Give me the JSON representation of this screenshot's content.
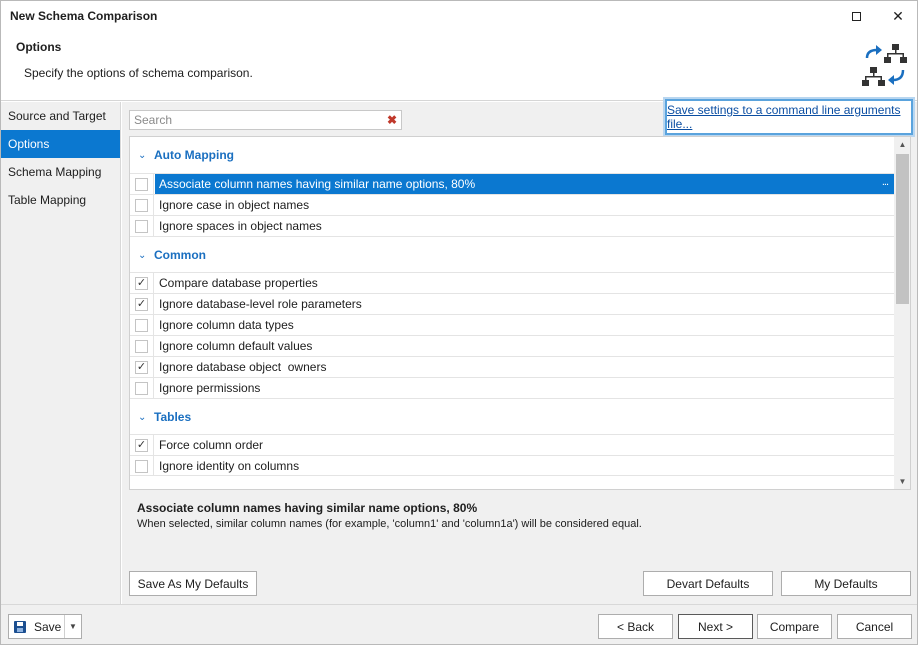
{
  "window": {
    "title": "New Schema Comparison",
    "maximize_icon": "maximize-icon",
    "close_glyph": "✕"
  },
  "header": {
    "title": "Options",
    "subtitle": "Specify the options of schema comparison.",
    "icon": "schema-compare-icon"
  },
  "sidebar": {
    "items": [
      {
        "label": "Source and Target",
        "active": false
      },
      {
        "label": "Options",
        "active": true
      },
      {
        "label": "Schema Mapping",
        "active": false
      },
      {
        "label": "Table Mapping",
        "active": false
      }
    ]
  },
  "search": {
    "placeholder": "Search",
    "value": "",
    "clear_glyph": "✖"
  },
  "save_settings_link": "Save settings to a command line arguments file...",
  "options": {
    "groups": [
      {
        "title": "Auto Mapping",
        "items": [
          {
            "label": "Associate column names having similar name options, 80%",
            "checked": false,
            "selected": true
          },
          {
            "label": "Ignore case in object names",
            "checked": false,
            "selected": false
          },
          {
            "label": "Ignore spaces in object names",
            "checked": false,
            "selected": false
          }
        ]
      },
      {
        "title": "Common",
        "items": [
          {
            "label": "Compare database properties",
            "checked": true,
            "selected": false
          },
          {
            "label": "Ignore database-level role parameters",
            "checked": true,
            "selected": false
          },
          {
            "label": "Ignore column data types",
            "checked": false,
            "selected": false
          },
          {
            "label": "Ignore column default values",
            "checked": false,
            "selected": false
          },
          {
            "label": "Ignore database object  owners",
            "checked": true,
            "selected": false
          },
          {
            "label": "Ignore permissions",
            "checked": false,
            "selected": false
          }
        ]
      },
      {
        "title": "Tables",
        "items": [
          {
            "label": "Force column order",
            "checked": true,
            "selected": false
          },
          {
            "label": "Ignore identity on columns",
            "checked": false,
            "selected": false
          }
        ]
      }
    ],
    "selected_ellipsis": "...",
    "check_glyph": "✓",
    "chevron_glyph": "⌄",
    "scroll_up_glyph": "▲",
    "scroll_down_glyph": "▼"
  },
  "description": {
    "title": "Associate column names having similar name options, 80%",
    "text": "When selected, similar column names (for example, 'column1' and 'column1a') will be considered equal."
  },
  "defaults_buttons": {
    "save_as_my_defaults": "Save As My Defaults",
    "devart_defaults": "Devart Defaults",
    "my_defaults": "My Defaults"
  },
  "footer": {
    "save": "Save",
    "save_dropdown_glyph": "▼",
    "back": "< Back",
    "next": "Next >",
    "compare": "Compare",
    "cancel": "Cancel"
  },
  "colors": {
    "accent": "#0b78d0",
    "group_title": "#1a6fc0",
    "link": "#0b4ea2"
  }
}
